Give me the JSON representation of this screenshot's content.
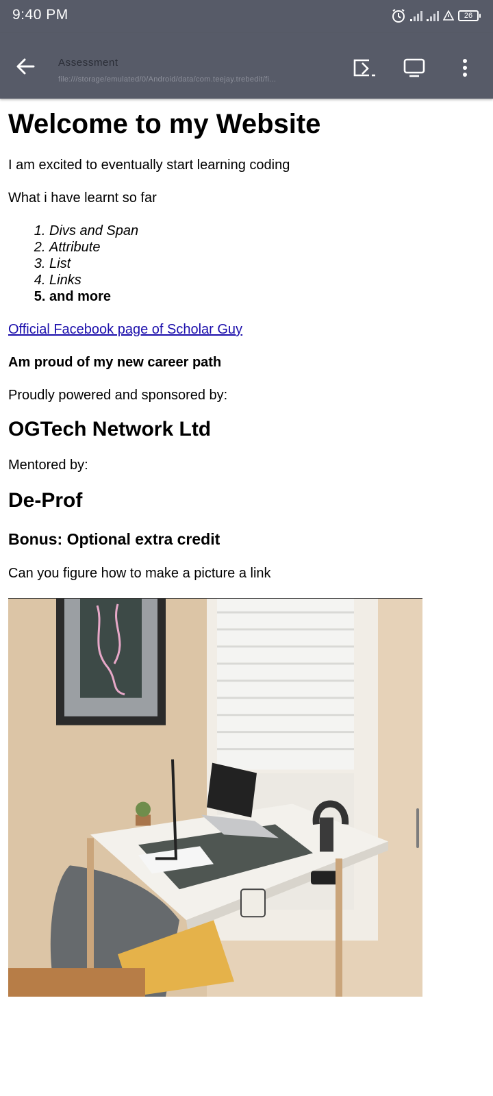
{
  "status_bar": {
    "time": "9:40 PM",
    "battery": "26"
  },
  "app_bar": {
    "title": "Assessment",
    "url": "file:///storage/emulated/0/Android/data/com.teejay.trebedit/fi..."
  },
  "page": {
    "heading": "Welcome to my Website",
    "intro": "I am excited to eventually start learning coding",
    "learnt_label": "What i have learnt so far",
    "learnt_items": [
      "Divs and Span",
      "Attribute",
      "List",
      "Links",
      "and more"
    ],
    "facebook_link": "Official Facebook page of Scholar Guy",
    "proud": "Am proud of my new career path",
    "powered": "Proudly powered and sponsored by:",
    "sponsor": "OGTech Network Ltd",
    "mentored": "Mentored by:",
    "mentor": "De-Prof",
    "bonus": "Bonus: Optional extra credit",
    "question": "Can you figure how to make a picture a link"
  },
  "colors": {
    "bar": "#575b68",
    "link": "#1a0dab"
  }
}
